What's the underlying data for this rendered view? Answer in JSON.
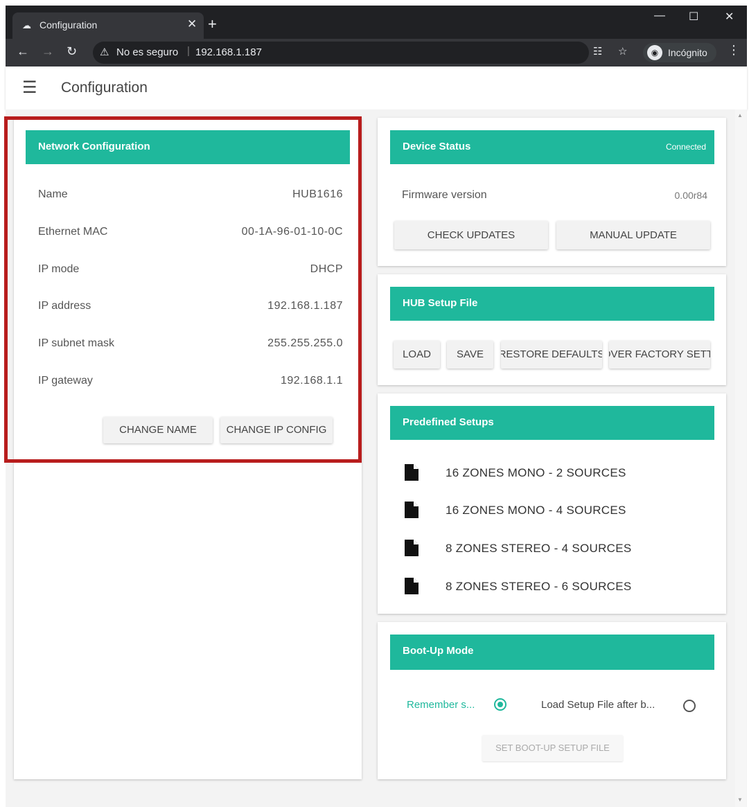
{
  "browser": {
    "tab_title": "Configuration",
    "new_tab_symbol": "+",
    "security_label": "No es seguro",
    "url": "192.168.1.187",
    "incognito_label": "Incógnito"
  },
  "appbar": {
    "title": "Configuration"
  },
  "network": {
    "header": "Network Configuration",
    "rows": [
      {
        "label": "Name",
        "value": "HUB1616"
      },
      {
        "label": "Ethernet MAC",
        "value": "00-1A-96-01-10-0C"
      },
      {
        "label": "IP mode",
        "value": "DHCP"
      },
      {
        "label": "IP address",
        "value": "192.168.1.187"
      },
      {
        "label": "IP subnet mask",
        "value": "255.255.255.0"
      },
      {
        "label": "IP gateway",
        "value": "192.168.1.1"
      }
    ],
    "change_name": "CHANGE NAME",
    "change_ip": "CHANGE IP CONFIG"
  },
  "device_status": {
    "header": "Device Status",
    "status": "Connected",
    "firmware_label": "Firmware version",
    "firmware_value": "0.00r84",
    "check_updates": "CHECK UPDATES",
    "manual_update": "MANUAL UPDATE"
  },
  "setup_file": {
    "header": "HUB Setup File",
    "load": "LOAD",
    "save": "SAVE",
    "restore": "RESTORE DEFAULTS",
    "recover": "RECOVER FACTORY SETTINGS"
  },
  "predefined": {
    "header": "Predefined Setups",
    "items": [
      "16 ZONES MONO - 2 SOURCES",
      "16 ZONES MONO - 4 SOURCES",
      "8 ZONES STEREO - 4 SOURCES",
      "8 ZONES STEREO - 6 SOURCES"
    ]
  },
  "bootup": {
    "header": "Boot-Up Mode",
    "option_remember": "Remember s...",
    "option_load": "Load Setup File after b...",
    "selected": "remember",
    "set_file": "SET BOOT-UP SETUP FILE"
  },
  "colors": {
    "accent": "#1fb89c",
    "highlight_border": "#b81d1d"
  }
}
